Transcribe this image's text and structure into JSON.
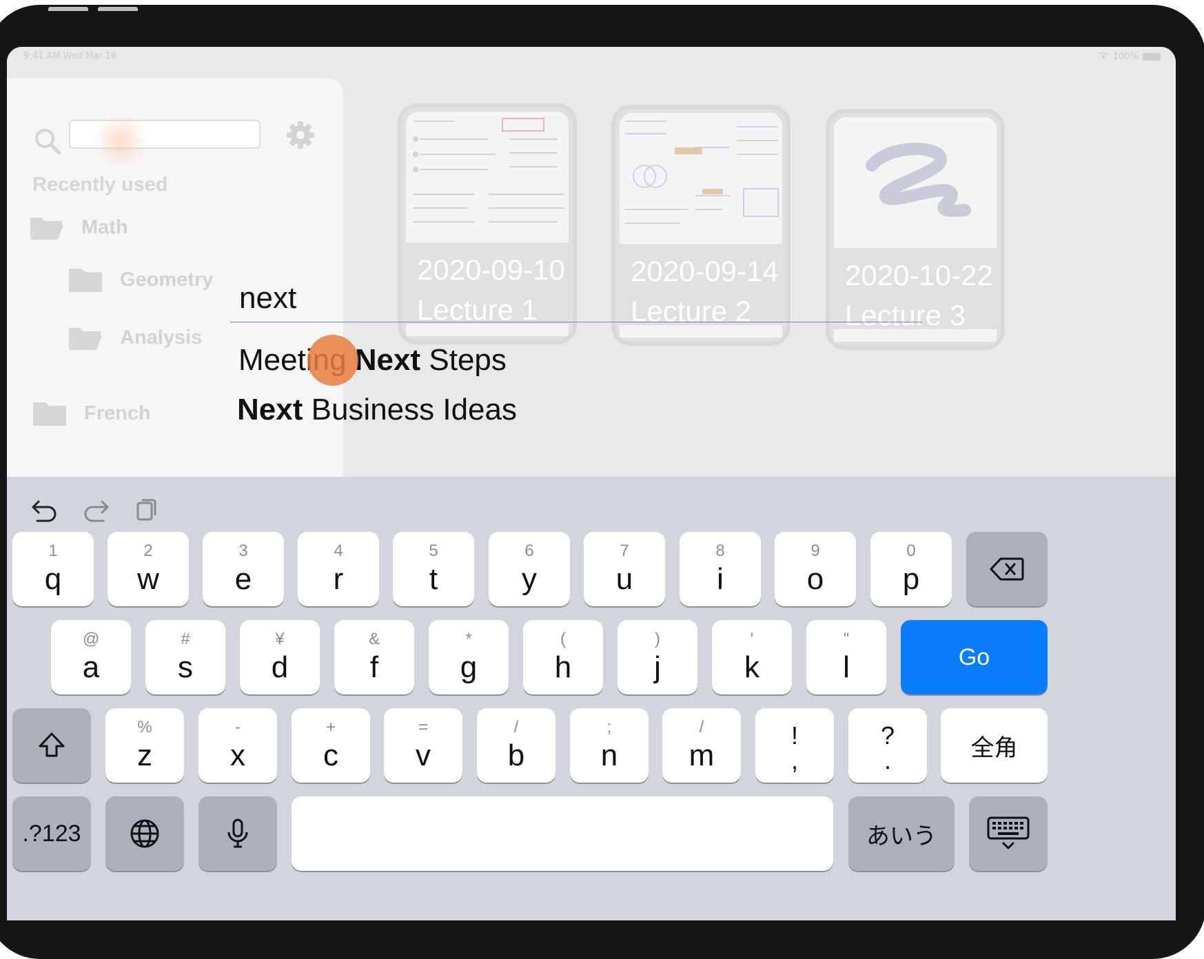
{
  "status_bar": {
    "time": "9:41 AM  Wed Mar 18",
    "battery": "100%"
  },
  "sidebar": {
    "section_label": "Recently used",
    "folders": [
      {
        "label": "Math",
        "level": 0
      },
      {
        "label": "Geometry",
        "level": 1
      },
      {
        "label": "Analysis",
        "level": 1
      },
      {
        "label": "French",
        "level": 0
      }
    ]
  },
  "notebooks": [
    {
      "date": "2020-09-10",
      "title": "Lecture 1"
    },
    {
      "date": "2020-09-14",
      "title": "Lecture 2"
    },
    {
      "date": "2020-10-22",
      "title": "Lecture 3"
    }
  ],
  "search": {
    "query": "next",
    "suggestions": [
      {
        "before": "Meeting ",
        "match": "Next",
        "after": " Steps"
      },
      {
        "before": "",
        "match": "Next",
        "after": " Business Ideas"
      }
    ]
  },
  "keyboard": {
    "row1": [
      {
        "sub": "1",
        "key": "q"
      },
      {
        "sub": "2",
        "key": "w"
      },
      {
        "sub": "3",
        "key": "e"
      },
      {
        "sub": "4",
        "key": "r"
      },
      {
        "sub": "5",
        "key": "t"
      },
      {
        "sub": "6",
        "key": "y"
      },
      {
        "sub": "7",
        "key": "u"
      },
      {
        "sub": "8",
        "key": "i"
      },
      {
        "sub": "9",
        "key": "o"
      },
      {
        "sub": "0",
        "key": "p"
      }
    ],
    "row2": [
      {
        "sub": "@",
        "key": "a"
      },
      {
        "sub": "#",
        "key": "s"
      },
      {
        "sub": "¥",
        "key": "d"
      },
      {
        "sub": "&",
        "key": "f"
      },
      {
        "sub": "*",
        "key": "g"
      },
      {
        "sub": "(",
        "key": "h"
      },
      {
        "sub": ")",
        "key": "j"
      },
      {
        "sub": "'",
        "key": "k"
      },
      {
        "sub": "\"",
        "key": "l"
      }
    ],
    "row3": [
      {
        "sub": "%",
        "key": "z"
      },
      {
        "sub": "-",
        "key": "x"
      },
      {
        "sub": "+",
        "key": "c"
      },
      {
        "sub": "=",
        "key": "v"
      },
      {
        "sub": "/",
        "key": "b"
      },
      {
        "sub": ";",
        "key": "n"
      },
      {
        "sub": "/",
        "key": "m"
      },
      {
        "sub": "!",
        "key": ","
      },
      {
        "sub": "?",
        "key": "."
      }
    ],
    "go_label": "Go",
    "full_width_label": "全角",
    "numbers_label": ".?123",
    "kana_label": "あいう",
    "space_label": ""
  }
}
